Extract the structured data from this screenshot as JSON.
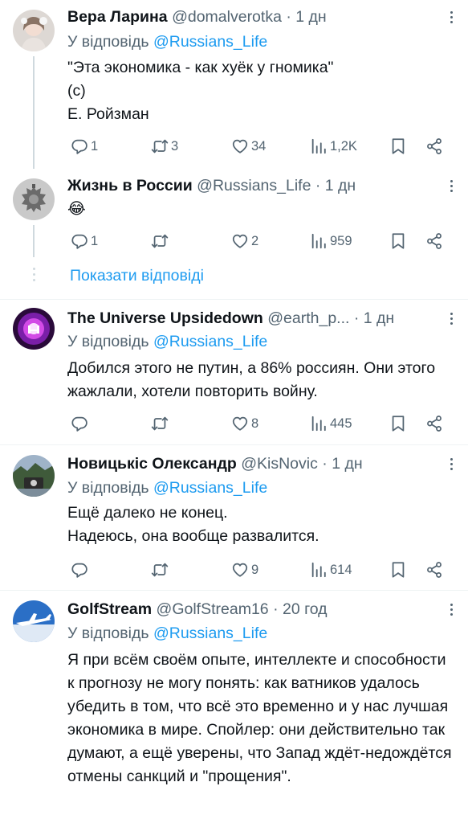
{
  "reply_prefix": "У відповідь",
  "show_replies": "Показати відповіді",
  "tweets": [
    {
      "name": "Вера Ларина",
      "handle": "@domalverotka",
      "time": "· 1 дн",
      "reply_to": "@Russians_Life",
      "text": "\"Эта экономика - как хуёк у гномика\"\n(с)\nЕ. Ройзман",
      "replies": "1",
      "retweets": "3",
      "likes": "34",
      "views": "1,2K"
    },
    {
      "name": "Жизнь в России",
      "handle": "@Russians_Life",
      "time": "· 1 дн",
      "text": "😂",
      "replies": "1",
      "retweets": "",
      "likes": "2",
      "views": "959"
    },
    {
      "name": "The Universe Upsidedown",
      "handle": "@earth_p...",
      "time": "· 1 дн",
      "reply_to": "@Russians_Life",
      "text": "Добился этого не путин, а 86% россиян. Они этого жажлали, хотели повторить войну.",
      "replies": "",
      "retweets": "",
      "likes": "8",
      "views": "445"
    },
    {
      "name": "Новицькіс Олександр",
      "handle": "@KisNovic",
      "time": "· 1 дн",
      "reply_to": "@Russians_Life",
      "text": "Ещё далеко не конец.\nНадеюсь, она вообще развалится.",
      "replies": "",
      "retweets": "",
      "likes": "9",
      "views": "614"
    },
    {
      "name": "GolfStream",
      "handle": "@GolfStream16",
      "time": "· 20 год",
      "reply_to": "@Russians_Life",
      "text": "Я при всём своём опыте, интеллекте и способности к прогнозу не могу понять: как ватников удалось убедить в том, что всё это временно и у нас лучшая экономика в мире. Спойлер: они действительно так думают, а ещё уверены, что Запад ждёт-недождётся отмены санкций и \"прощения\"."
    }
  ]
}
